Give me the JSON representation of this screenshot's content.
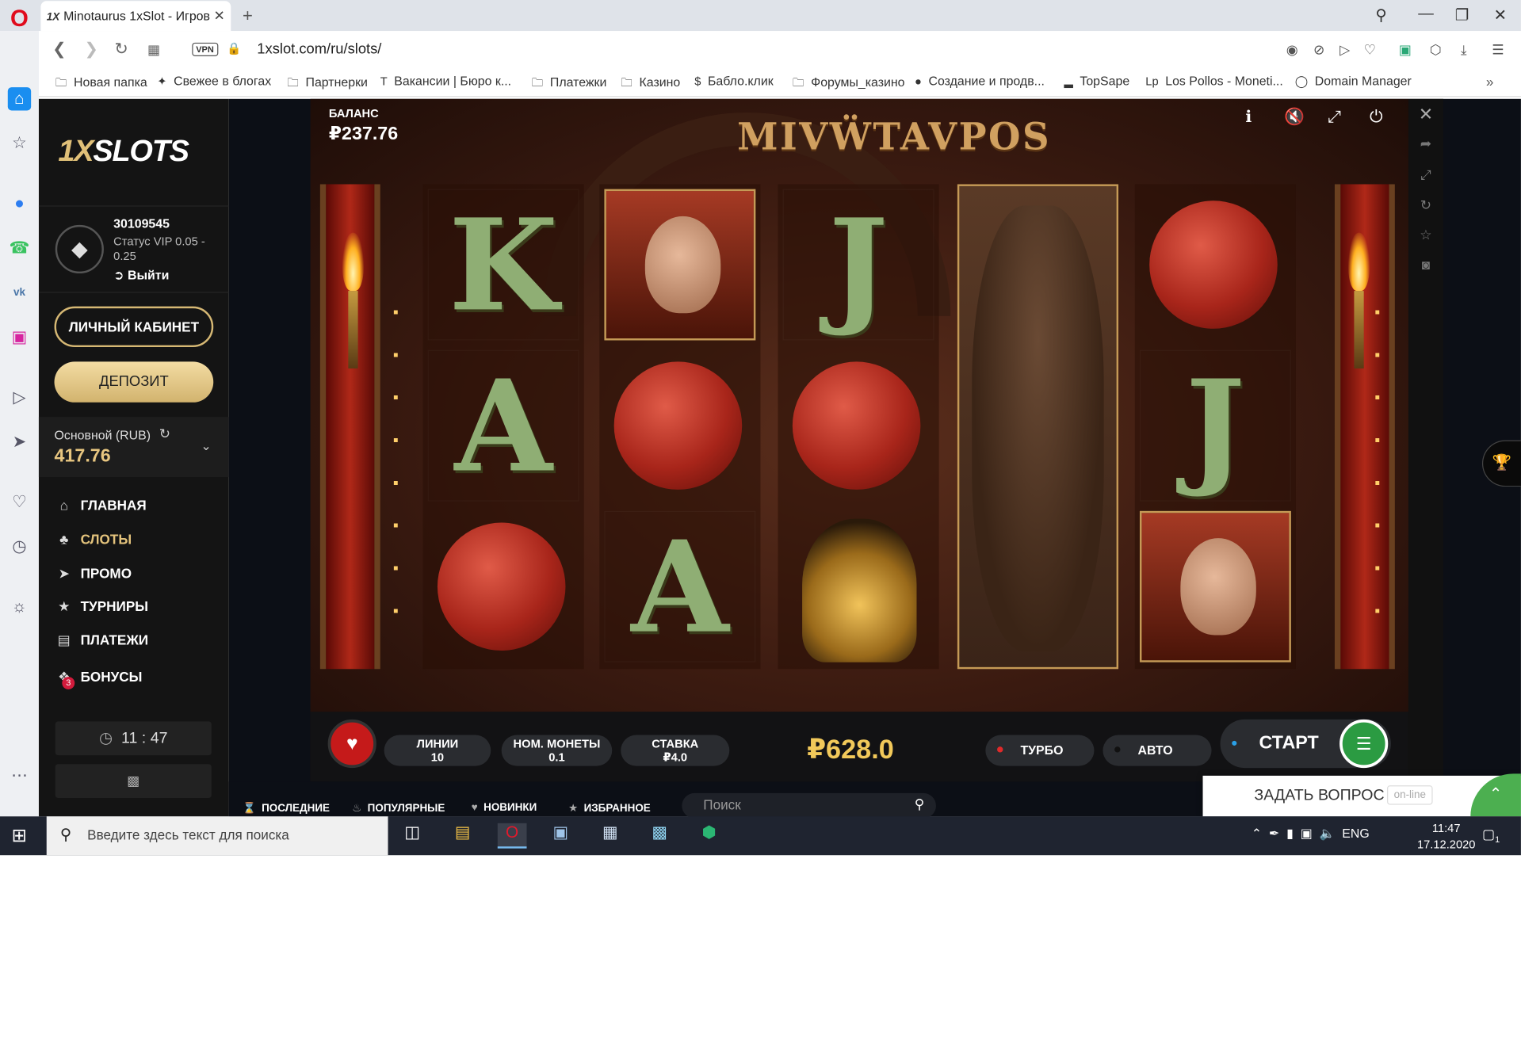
{
  "browser": {
    "tab_title": "Minotaurus 1xSlot - Игров",
    "tab_favicon": "1X",
    "tab_close": "✕",
    "new_tab": "+",
    "url": "1xslot.com/ru/slots/",
    "vpn_badge": "VPN",
    "bookmarks": [
      {
        "label": "Новая папка",
        "icon": "folder-icon"
      },
      {
        "label": "Свежее в блогах",
        "icon": "blog-icon"
      },
      {
        "label": "Партнерки",
        "icon": "folder-icon"
      },
      {
        "label": "Вакансии | Бюро к...",
        "icon": "t-icon"
      },
      {
        "label": "Платежки",
        "icon": "folder-icon"
      },
      {
        "label": "Казино",
        "icon": "folder-icon"
      },
      {
        "label": "Бабло.клик",
        "icon": "dollar-icon"
      },
      {
        "label": "Форумы_казино",
        "icon": "folder-icon"
      },
      {
        "label": "Создание и продв...",
        "icon": "avatar-icon"
      },
      {
        "label": "TopSape",
        "icon": "chart-icon"
      },
      {
        "label": "Los Pollos - Moneti...",
        "icon": "lp-icon"
      },
      {
        "label": "Domain Manager",
        "icon": "domain-icon"
      }
    ]
  },
  "site": {
    "logo_prefix": "1X",
    "logo_suffix": "SLOTS",
    "user_id": "30109545",
    "user_status": "Статус VIP 0.05 - 0.25",
    "logout": "Выйти",
    "cabinet_button": "ЛИЧНЫЙ КАБИНЕТ",
    "deposit_button": "ДЕПОЗИТ",
    "account_label": "Основной (RUB)",
    "account_balance": "417.76",
    "menu": [
      {
        "label": "ГЛАВНАЯ",
        "icon": "home-icon",
        "active": false
      },
      {
        "label": "СЛОТЫ",
        "icon": "cherries-icon",
        "active": true
      },
      {
        "label": "ПРОМО",
        "icon": "megaphone-icon",
        "active": false
      },
      {
        "label": "ТУРНИРЫ",
        "icon": "trophy-icon",
        "active": false
      },
      {
        "label": "ПЛАТЕЖИ",
        "icon": "wallet-icon",
        "active": false
      },
      {
        "label": "БОНУСЫ",
        "icon": "gift-icon",
        "active": false
      }
    ],
    "bonus_badge": "3",
    "clock_hours": "11",
    "clock_minutes": "47",
    "bottom_tabs": [
      {
        "label": "ПОСЛЕДНИЕ",
        "icon": "hourglass-icon"
      },
      {
        "label": "ПОПУЛЯРНЫЕ",
        "icon": "flame-icon"
      },
      {
        "label": "НОВИНКИ",
        "icon": "heart-icon"
      },
      {
        "label": "ИЗБРАННОЕ",
        "icon": "star-icon"
      }
    ],
    "search_placeholder": "Поиск",
    "ask_question": "ЗАДАТЬ ВОПРОС",
    "online_badge": "on-line"
  },
  "game": {
    "title": "MIVẄTAVPOS",
    "balance_label": "БАЛАНС",
    "balance_value": "₽237.76",
    "reels": [
      [
        "K",
        "A",
        "yarn"
      ],
      [
        "woman-portrait",
        "yarn",
        "A"
      ],
      [
        "J",
        "yarn",
        "helmet"
      ],
      [
        "minotaur",
        "minotaur",
        "minotaur"
      ],
      [
        "yarn",
        "J",
        "man-portrait"
      ]
    ],
    "lines_label": "ЛИНИИ",
    "lines_value": "10",
    "coin_label": "НОМ. МОНЕТЫ",
    "coin_value": "0.1",
    "bet_label": "СТАВКА",
    "bet_value": "₽4.0",
    "win_value": "₽628.0",
    "turbo_label": "ТУРБО",
    "auto_label": "АВТО",
    "start_label": "СТАРТ"
  },
  "taskbar": {
    "search_placeholder": "Введите здесь текст для поиска",
    "language": "ENG",
    "time": "11:47",
    "date": "17.12.2020",
    "notifications": "1"
  }
}
